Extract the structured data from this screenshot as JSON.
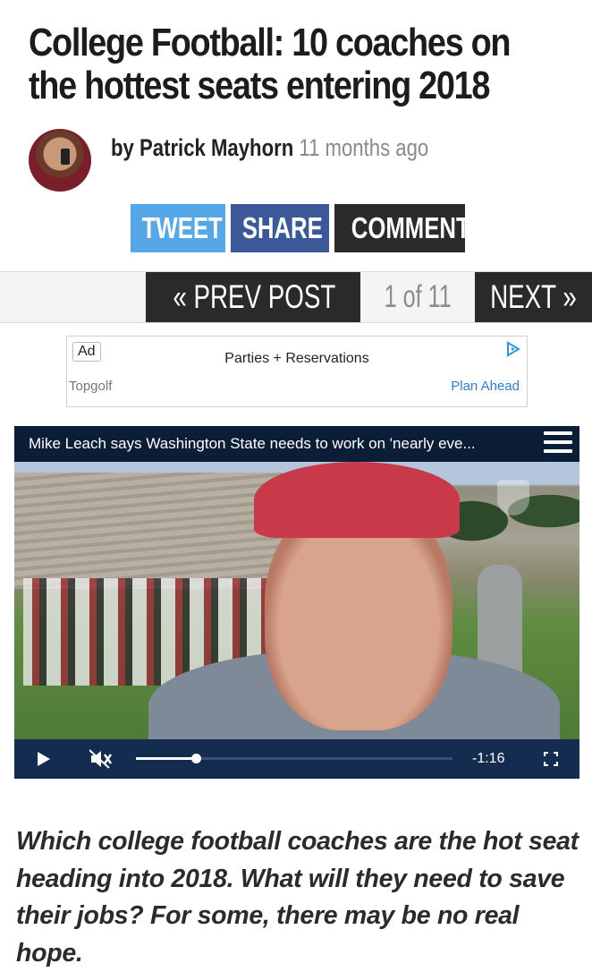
{
  "article": {
    "title_line1": "College Football: 10 coaches on",
    "title_line2": "the hottest seats entering 2018",
    "byline": "by Patrick Mayhorn",
    "timestamp": "11 months ago",
    "intro": "Which college football coaches are the hot seat heading into 2018. What will they need to save their jobs? For some, there may be no real hope."
  },
  "share": {
    "tweet_label": "TWEET",
    "share_label": "SHARE",
    "comment_label": "COMMENT",
    "colors": {
      "tweet": "#55a7e8",
      "share": "#3b5998",
      "comment": "#2b2b2b"
    }
  },
  "pager": {
    "prev_label": "« PREV POST",
    "page_indicator": "1 of 11",
    "next_label": "NEXT »",
    "current_page": 1,
    "total_pages": 11
  },
  "ad": {
    "badge": "Ad",
    "title": "Parties + Reservations",
    "advertiser": "Topgolf",
    "cta": "Plan Ahead"
  },
  "video": {
    "title": "Mike Leach says Washington State needs to work on 'nearly eve...",
    "time_remaining": "-1:16",
    "progress_fraction": 0.19,
    "icons": [
      "menu-icon",
      "play-icon",
      "mute-icon",
      "fullscreen-icon"
    ]
  }
}
